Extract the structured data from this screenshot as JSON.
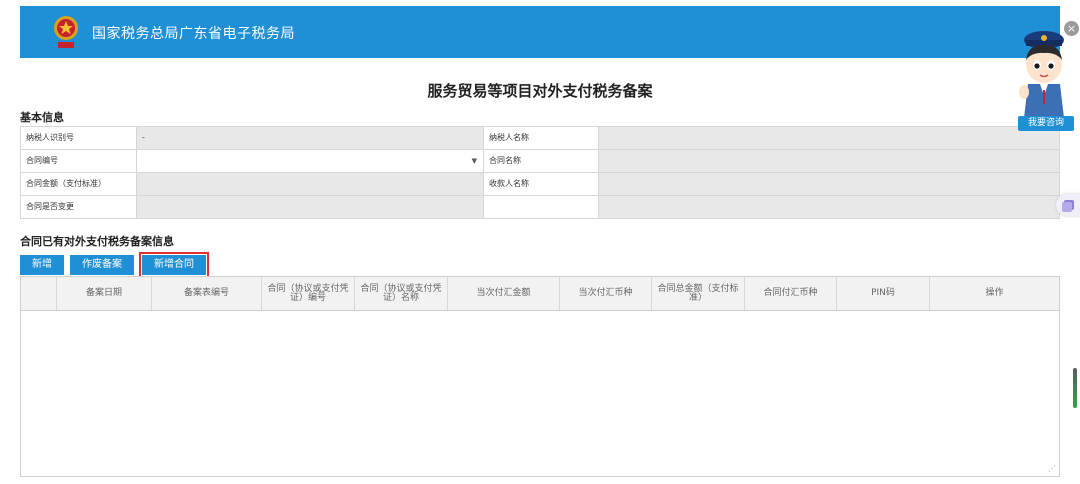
{
  "header": {
    "title": "国家税务总局广东省电子税务局"
  },
  "page_title": "服务贸易等项目对外支付税务备案",
  "basic_info": {
    "section_title": "基本信息",
    "rows": [
      {
        "label1": "纳税人识别号",
        "value1": "-",
        "label2": "纳税人名称",
        "value2": ""
      },
      {
        "label1": "合同编号",
        "value1": "",
        "label2": "合同名称",
        "value2": ""
      },
      {
        "label1": "合同金额（支付标准）",
        "value1": "",
        "label2": "收款人名称",
        "value2": ""
      },
      {
        "label1": "合同是否变更",
        "value1": "",
        "label2": "",
        "value2": ""
      }
    ]
  },
  "records": {
    "section_title": "合同已有对外支付税务备案信息",
    "buttons": {
      "add": "新增",
      "void": "作废备案",
      "add_contract": "新增合同"
    },
    "columns": [
      "",
      "备案日期",
      "备案表编号",
      "合同（协议或支付凭证）编号",
      "合同（协议或支付凭证）名称",
      "当次付汇金额",
      "当次付汇币种",
      "合同总金额（支付标准）",
      "合同付汇币种",
      "PIN码",
      "操作"
    ],
    "rows": []
  },
  "widgets": {
    "consult_label": "我要咨询",
    "close_glyph": "×",
    "resize_glyph": "⋰"
  },
  "colors": {
    "brand_blue": "#1f8fd6",
    "highlight_red": "#e0312e",
    "readonly_gray": "#e8e8e8"
  }
}
